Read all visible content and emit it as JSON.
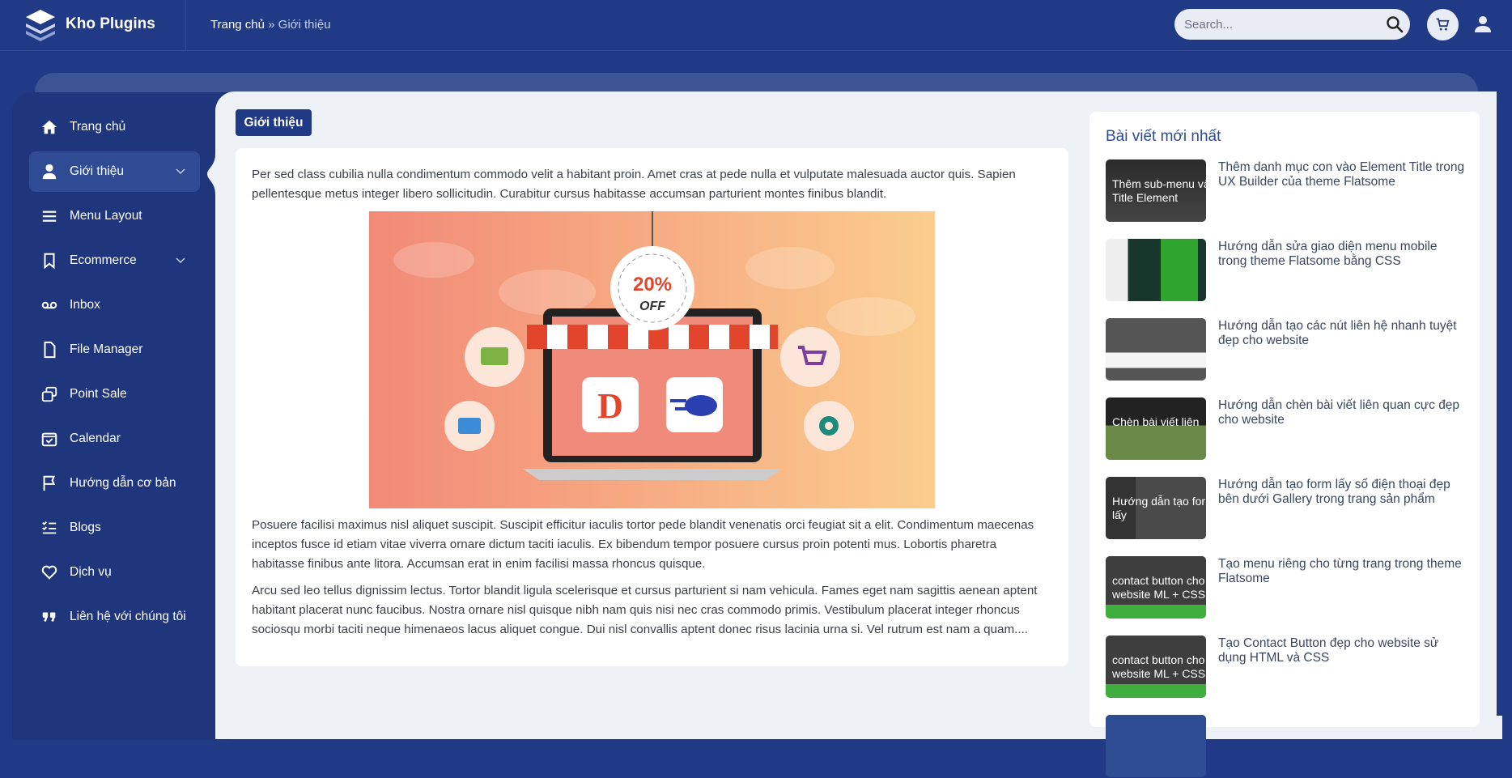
{
  "header": {
    "brand": "Kho Plugins",
    "breadcrumb_home": "Trang chủ",
    "breadcrumb_sep": " » ",
    "breadcrumb_current": "Giới thiệu",
    "search_placeholder": "Search..."
  },
  "sidebar": {
    "items": [
      {
        "label": "Trang chủ",
        "icon": "home-icon"
      },
      {
        "label": "Giới thiệu",
        "icon": "user-icon",
        "active": true,
        "chevron": true
      },
      {
        "label": "Menu Layout",
        "icon": "menu-icon"
      },
      {
        "label": "Ecommerce",
        "icon": "bookmark-icon",
        "chevron": true
      },
      {
        "label": "Inbox",
        "icon": "voicemail-icon"
      },
      {
        "label": "File Manager",
        "icon": "file-icon"
      },
      {
        "label": "Point Sale",
        "icon": "windows-icon"
      },
      {
        "label": "Calendar",
        "icon": "calendar-check-icon"
      },
      {
        "label": "Hướng dẫn cơ bản",
        "icon": "flag-icon"
      },
      {
        "label": "Blogs",
        "icon": "checklist-icon"
      },
      {
        "label": "Dịch vụ",
        "icon": "heart-icon"
      },
      {
        "label": "Liên hệ với chúng tôi",
        "icon": "quote-icon"
      }
    ]
  },
  "main": {
    "tag_button": "Giới thiệu",
    "paragraphs": [
      "Per sed class cubilia nulla condimentum commodo velit a habitant proin. Amet cras at pede nulla et vulputate malesuada auctor quis. Sapien pellentesque metus integer libero sollicitudin. Curabitur cursus habitasse accumsan parturient montes finibus blandit.",
      "Posuere facilisi maximus nisl aliquet suscipit. Suscipit efficitur iaculis tortor pede blandit venenatis orci feugiat sit a elit. Condimentum maecenas inceptos fusce id etiam vitae viverra ornare dictum taciti iaculis. Ex bibendum tempor posuere cursus proin potenti mus. Lobortis pharetra habitasse finibus ante litora. Accumsan erat in enim facilisi massa rhoncus quisque.",
      "Arcu sed leo tellus dignissim lectus. Tortor blandit ligula scelerisque et cursus parturient si nam vehicula. Fames eget nam sagittis aenean aptent habitant placerat nunc faucibus. Nostra ornare nisl quisque nibh nam quis nisi nec cras commodo primis. Vestibulum placerat integer rhoncus sociosqu morbi taciti neque himenaeos lacus aliquet congue. Dui nisl convallis aptent donec risus lacinia urna si. Vel rutrum est nam a quam...."
    ],
    "hero": {
      "tag_percent": "20%",
      "tag_off": "OFF"
    }
  },
  "recent": {
    "title": "Bài viết mới nhất",
    "posts": [
      {
        "title": "Thêm danh mục con vào Element Title trong UX Builder của theme Flatsome",
        "thumb_text": "Thêm sub-menu vào Title Element"
      },
      {
        "title": "Hướng dẫn sửa giao diện menu mobile trong theme Flatsome bằng CSS",
        "thumb_text": ""
      },
      {
        "title": "Hướng dẫn tạo các nút liên hệ nhanh tuyệt đẹp cho website",
        "thumb_text": ""
      },
      {
        "title": "Hướng dẫn chèn bài viết liên quan cực đẹp cho website",
        "thumb_text": "Chèn bài viết liên"
      },
      {
        "title": "Hướng dẫn tạo form lấy số điện thoại đẹp bên dưới Gallery trong trang sản phẩm",
        "thumb_text": "Hướng dẫn tạo form lấy"
      },
      {
        "title": "Tạo menu riêng cho từng trang trong theme Flatsome",
        "thumb_text": "contact button cho website ML + CSS"
      },
      {
        "title": "Tạo Contact Button đẹp cho website sử dụng HTML và CSS",
        "thumb_text": "contact button cho website ML + CSS"
      }
    ]
  },
  "colors": {
    "primary": "#213a85",
    "sidebar": "#1f367d",
    "content_bg": "#eef2f7",
    "title": "#2d4c92"
  }
}
